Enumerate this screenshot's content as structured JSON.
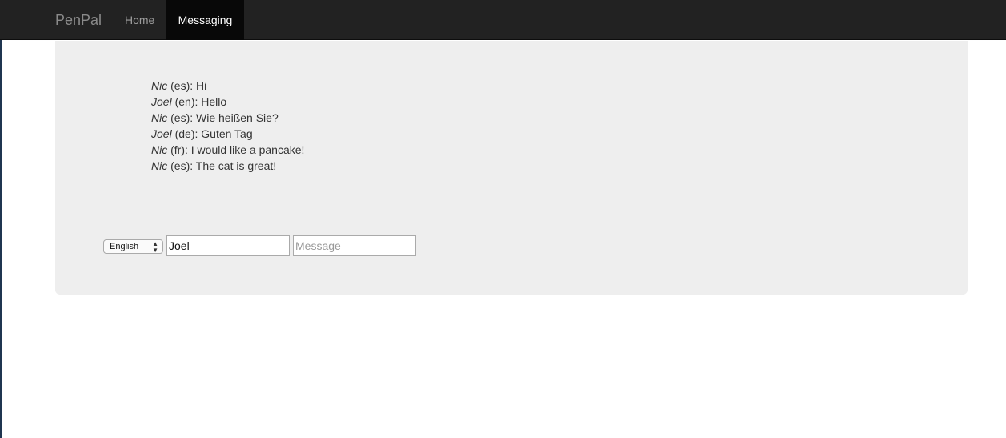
{
  "navbar": {
    "brand": "PenPal",
    "items": [
      {
        "label": "Home"
      },
      {
        "label": "Messaging",
        "active": true
      }
    ]
  },
  "messages": [
    {
      "sender": "Nic",
      "lang": "(es):",
      "text": "Hi"
    },
    {
      "sender": "Joel",
      "lang": "(en):",
      "text": "Hello"
    },
    {
      "sender": "Nic",
      "lang": "(es):",
      "text": "Wie heißen Sie?"
    },
    {
      "sender": "Joel",
      "lang": "(de):",
      "text": "Guten Tag"
    },
    {
      "sender": "Nic",
      "lang": "(fr):",
      "text": "I would like a pancake!"
    },
    {
      "sender": "Nic",
      "lang": "(es):",
      "text": "The cat is great!"
    }
  ],
  "composer": {
    "language": {
      "selected": "English",
      "icon": "select-arrows-icon"
    },
    "name": {
      "value": "Joel"
    },
    "message": {
      "value": "",
      "placeholder": "Message"
    }
  },
  "colors": {
    "navbar_bg": "#222222",
    "active_tab_bg": "#080808",
    "panel_bg": "#eeeeee"
  }
}
